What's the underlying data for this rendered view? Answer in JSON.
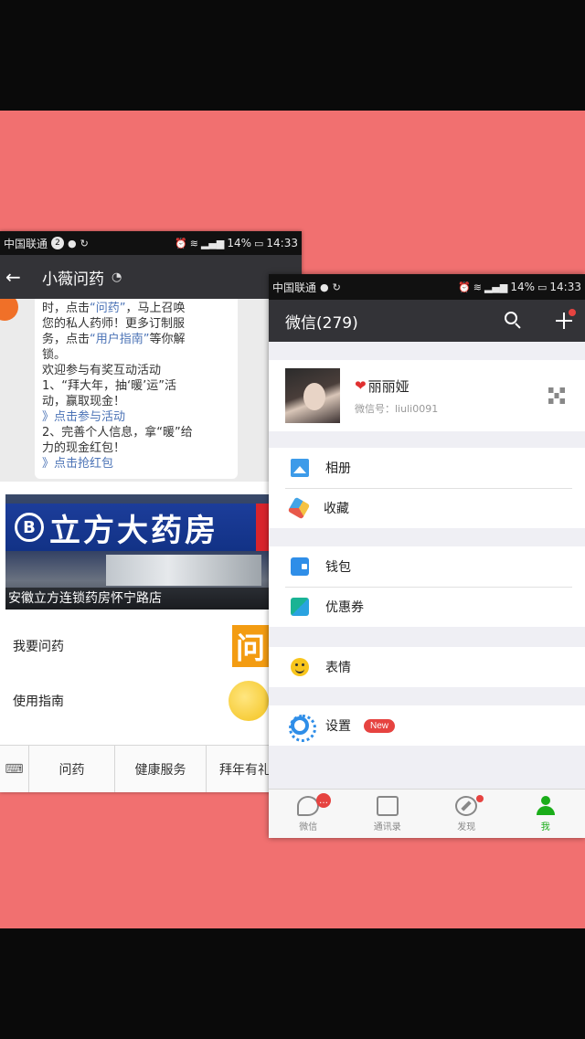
{
  "left": {
    "status": {
      "carrier": "中国联通",
      "sim_badge": "2",
      "battery": "14%",
      "time": "14:33"
    },
    "header": {
      "title": "小薇问药"
    },
    "message": {
      "line1_pre": "时，点击",
      "line1_link": "“问药”",
      "line1_post": "，马上召唤",
      "line2": "您的私人药师！更多订制服",
      "line3_pre": "务，点击",
      "line3_link": "“用户指南”",
      "line3_post": "等你解",
      "line4": "锁。",
      "line5": "欢迎参与有奖互动活动",
      "line6": "1、“拜大年，抽‘暖’运”活",
      "line7": "动，赢取现金！",
      "line8": "》点击参与活动",
      "line9": "2、完善个人信息，拿“暖”给",
      "line10": "力的现金红包！",
      "line11": "》点击抢红包"
    },
    "store": {
      "sign_logo": "B",
      "sign_text": "立方大药房",
      "caption": "安徽立方连锁药房怀宁路店"
    },
    "menu": [
      {
        "label": "我要问药",
        "thumb_text": "问"
      },
      {
        "label": "使用指南"
      }
    ],
    "footer": {
      "keyboard_icon": "⌨",
      "items": [
        "问药",
        "健康服务",
        "拜年有礼"
      ]
    }
  },
  "right": {
    "status": {
      "carrier": "中国联通",
      "battery": "14%",
      "time": "14:33"
    },
    "header": {
      "title": "微信(279)"
    },
    "profile": {
      "heart": "❤",
      "name": "丽丽娅",
      "wechat_id": "微信号：liuli0091"
    },
    "groups": [
      [
        {
          "label": "相册",
          "icon": "photo-album-icon"
        },
        {
          "label": "收藏",
          "icon": "favorites-icon"
        }
      ],
      [
        {
          "label": "钱包",
          "icon": "wallet-icon"
        },
        {
          "label": "优惠券",
          "icon": "coupon-icon"
        }
      ],
      [
        {
          "label": "表情",
          "icon": "sticker-icon"
        }
      ],
      [
        {
          "label": "设置",
          "icon": "settings-icon",
          "badge": "New"
        }
      ]
    ],
    "tabs": [
      {
        "label": "微信",
        "badge": "…"
      },
      {
        "label": "通讯录"
      },
      {
        "label": "发现"
      },
      {
        "label": "我"
      }
    ],
    "colors": {
      "accent_green": "#1aad19",
      "header_dark": "#333337",
      "badge_red": "#e64340",
      "backdrop_pink": "#f17070"
    }
  }
}
